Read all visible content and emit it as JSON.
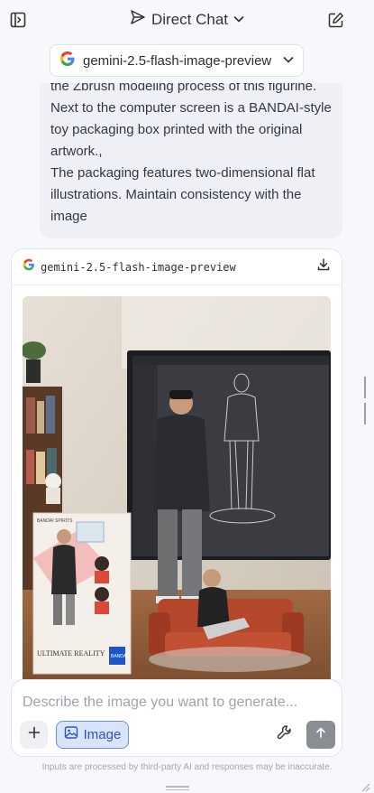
{
  "header": {
    "title": "Direct Chat",
    "model": "gemini-2.5-flash-image-preview"
  },
  "chat": {
    "user_message": "the Zbrush modeling process of this figurine.\nNext to the computer screen is a BANDAI-style toy packaging box printed with the original artwork.,\nThe packaging features two-dimensional flat illustrations. Maintain consistency with the image",
    "response": {
      "model_name": "gemini-2.5-flash-image-preview",
      "image": {
        "box_brand": "BANDAI SPIRITS",
        "box_title": "ULTIMATE REALITY",
        "box_logo": "BANDAI"
      }
    }
  },
  "composer": {
    "placeholder": "Describe the image you want to generate...",
    "image_label": "Image"
  },
  "footer": {
    "disclaimer": "Inputs are processed by third-party AI and responses may be inaccurate."
  },
  "icons": {
    "sidebar_toggle": "sidebar-toggle-icon",
    "title_logo": "paper-plane-icon",
    "title_caret": "chevron-down-icon",
    "new_chat": "edit-icon",
    "model_logo": "google-logo",
    "download": "download-icon",
    "add": "plus-icon",
    "image": "image-icon",
    "tools": "wrench-icon",
    "send": "arrow-up-icon"
  }
}
